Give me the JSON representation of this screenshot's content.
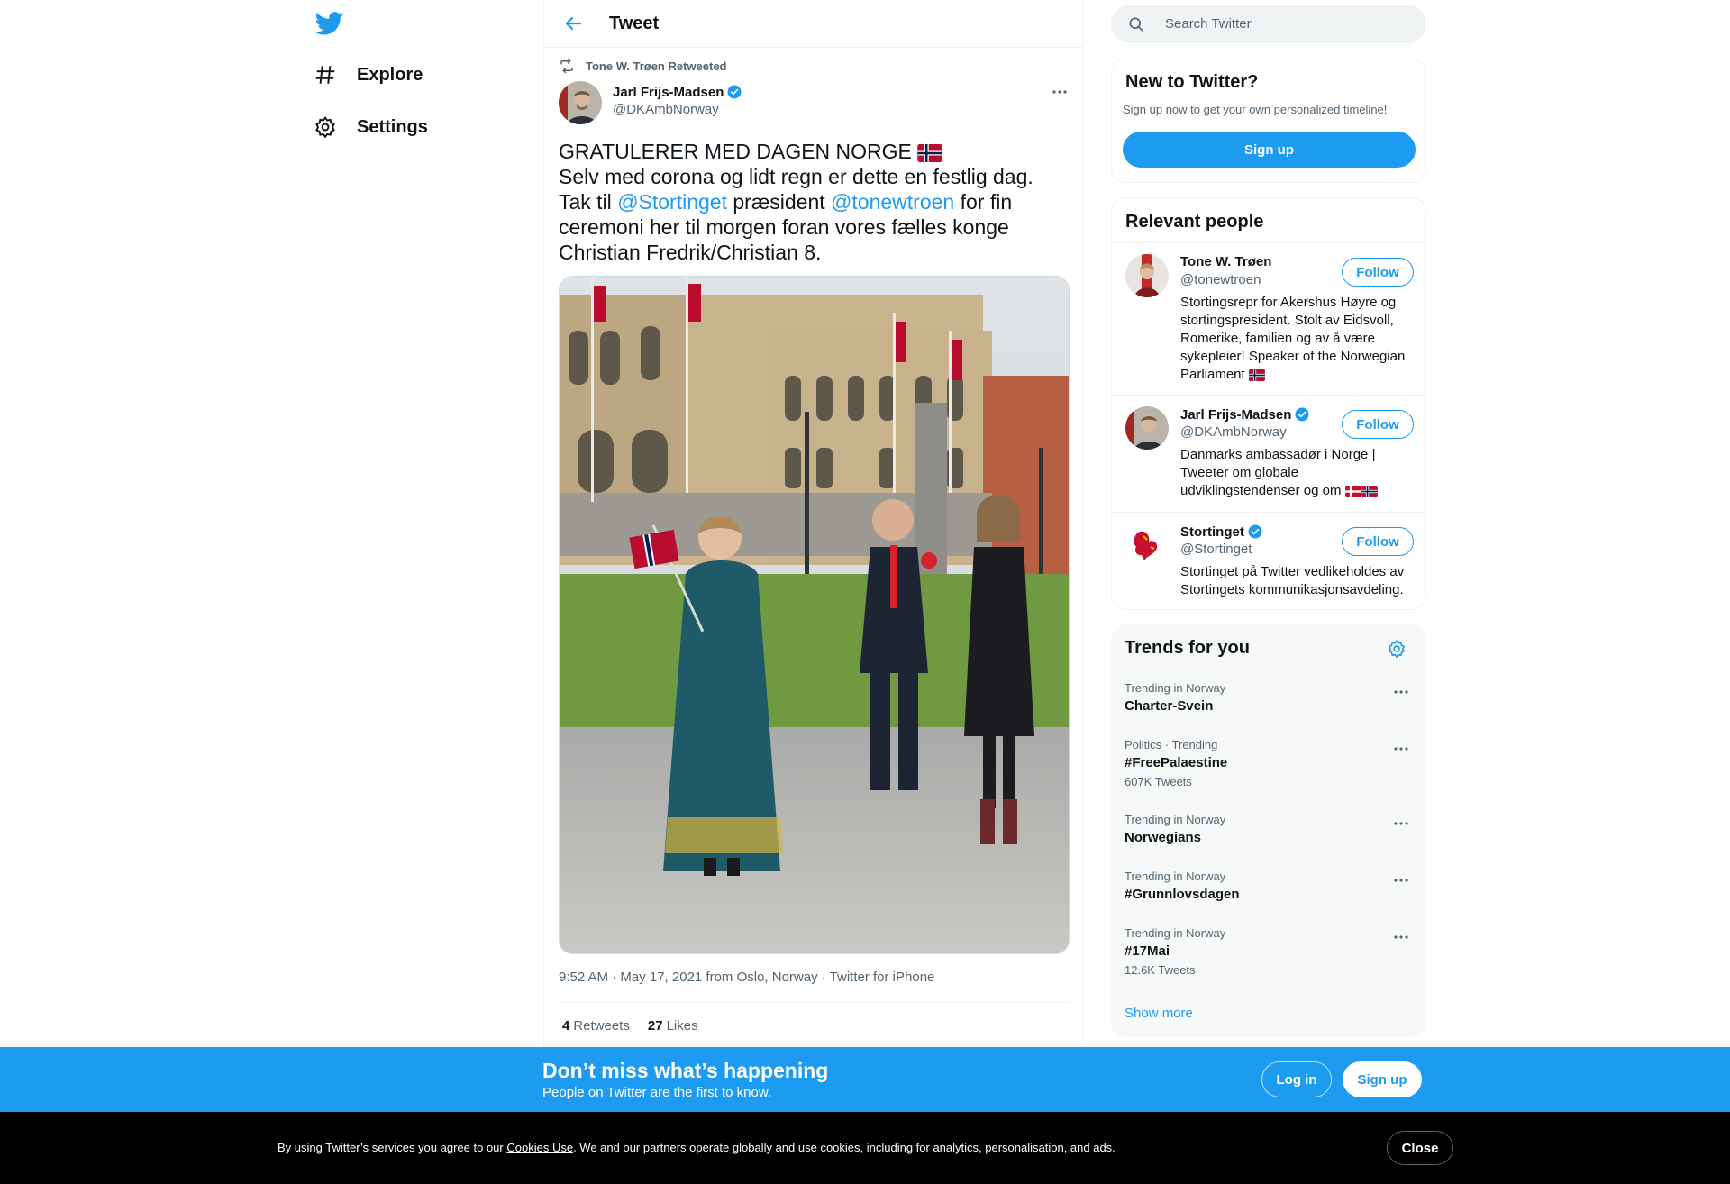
{
  "nav": {
    "explore_label": "Explore",
    "settings_label": "Settings"
  },
  "header": {
    "title": "Tweet"
  },
  "tweet": {
    "retweeted_by": "Tone W. Trøen Retweeted",
    "author_name": "Jarl Frijs-Madsen",
    "author_handle": "@DKAmbNorway",
    "line1": "GRATULERER MED DAGEN NORGE",
    "line2": "Selv med corona og lidt regn er dette en festlig dag.",
    "line3_a": "Tak til ",
    "mention1": "@Stortinget",
    "line3_b": " præsident ",
    "mention2": "@tonewtroen",
    "line3_c": " for fin ceremoni her til morgen foran vores fælles konge Christian Fredrik/Christian 8.",
    "meta": "9:52 AM · May 17, 2021 from Oslo, Norway · Twitter for iPhone",
    "retweets_count": "4",
    "retweets_label": "Retweets",
    "likes_count": "27",
    "likes_label": "Likes"
  },
  "search": {
    "placeholder": "Search Twitter"
  },
  "new_to_twitter": {
    "title": "New to Twitter?",
    "subtitle": "Sign up now to get your own personalized timeline!",
    "button": "Sign up"
  },
  "relevant_people": {
    "title": "Relevant people",
    "people": [
      {
        "name": "Tone W. Trøen",
        "handle": "@tonewtroen",
        "bio": "Stortingsrepr for Akershus Høyre og stortingspresident. Stolt av Eidsvoll, Romerike, familien og av å være sykepleier! Speaker of the Norwegian Parliament",
        "follow": "Follow"
      },
      {
        "name": "Jarl Frijs-Madsen",
        "handle": "@DKAmbNorway",
        "bio": "Danmarks ambassadør i Norge | Tweeter om globale udviklingstendenser og om",
        "follow": "Follow"
      },
      {
        "name": "Stortinget",
        "handle": "@Stortinget",
        "bio": "Stortinget på Twitter vedlikeholdes av Stortingets kommunikasjonsavdeling.",
        "follow": "Follow"
      }
    ]
  },
  "trends": {
    "title": "Trends for you",
    "items": [
      {
        "context": "Trending in Norway",
        "name": "Charter-Svein",
        "count": ""
      },
      {
        "context": "Politics · Trending",
        "name": "#FreePalaestine",
        "count": "607K Tweets"
      },
      {
        "context": "Trending in Norway",
        "name": "Norwegians",
        "count": ""
      },
      {
        "context": "Trending in Norway",
        "name": "#Grunnlovsdagen",
        "count": ""
      },
      {
        "context": "Trending in Norway",
        "name": "#17Mai",
        "count": "12.6K Tweets"
      }
    ],
    "show_more": "Show more"
  },
  "banner": {
    "title": "Don’t miss what’s happening",
    "subtitle": "People on Twitter are the first to know.",
    "login": "Log in",
    "signup": "Sign up"
  },
  "cookie": {
    "text_a": "By using Twitter’s services you agree to our ",
    "link": "Cookies Use",
    "text_b": ". We and our partners operate globally and use cookies, including for analytics, personalisation, and ads.",
    "close": "Close"
  },
  "colors": {
    "accent": "#1d9bf0",
    "text": "#0f1419",
    "secondary": "#536471",
    "border": "#eff3f4",
    "cookie_bg": "#000000"
  },
  "icons": [
    "twitter-logo-icon",
    "hashtag-icon",
    "gear-icon",
    "back-arrow-icon",
    "retweet-icon",
    "verified-icon",
    "more-icon",
    "search-icon",
    "norway-flag-icon",
    "denmark-flag-icon"
  ]
}
